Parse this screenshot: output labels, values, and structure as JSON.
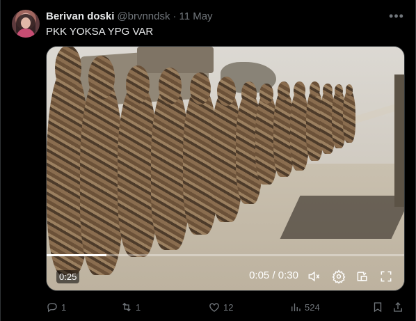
{
  "tweet": {
    "author": "Berivan doski",
    "handle": "@brvnndsk",
    "separator": "·",
    "date": "11 May",
    "text": "PKK YOKSA YPG VAR"
  },
  "video": {
    "badge_time": "0:25",
    "current_time": "0:05",
    "time_separator": "/",
    "duration": "0:30",
    "progress_fraction": 0.167
  },
  "actions": {
    "reply_count": "1",
    "retweet_count": "1",
    "like_count": "12",
    "view_count": "524"
  },
  "colors": {
    "background": "#000000",
    "text": "#e7e9ea",
    "muted": "#71767b",
    "divider": "#2f3336"
  },
  "icons": {
    "more": "more-icon",
    "mute": "volume-mute-icon",
    "settings": "gear-icon",
    "pip": "picture-in-picture-icon",
    "fullscreen": "fullscreen-icon",
    "reply": "reply-icon",
    "retweet": "retweet-icon",
    "like": "heart-icon",
    "views": "analytics-icon",
    "bookmark": "bookmark-icon",
    "share": "share-icon"
  }
}
